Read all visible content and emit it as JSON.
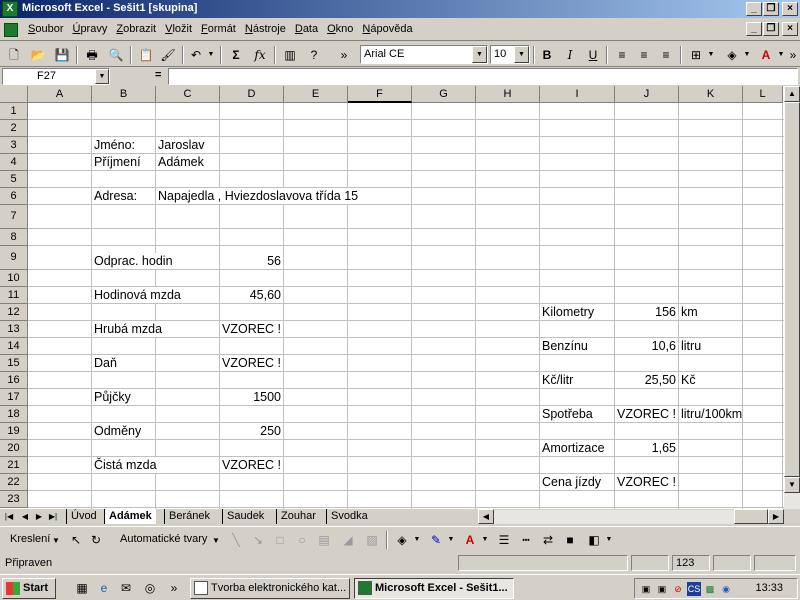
{
  "window": {
    "title": "Microsoft Excel - Sešit1  [skupina]"
  },
  "menu": [
    "Soubor",
    "Úpravy",
    "Zobrazit",
    "Vložit",
    "Formát",
    "Nástroje",
    "Data",
    "Okno",
    "Nápověda"
  ],
  "toolbar": {
    "font": "Arial CE",
    "size": "10"
  },
  "formula_bar": {
    "cell_ref": "F27",
    "eq": "=",
    "content": ""
  },
  "columns": [
    "A",
    "B",
    "C",
    "D",
    "E",
    "F",
    "G",
    "H",
    "I",
    "J",
    "K",
    "L"
  ],
  "rows": [
    "1",
    "2",
    "3",
    "4",
    "5",
    "6",
    "7",
    "8",
    "9",
    "10",
    "11",
    "12",
    "13",
    "14",
    "15",
    "16",
    "17",
    "18",
    "19",
    "20",
    "21",
    "22",
    "23"
  ],
  "cells": {
    "B3": "Jméno:",
    "C3": "Jaroslav",
    "B4": "Příjmení",
    "C4": "Adámek",
    "B6": "Adresa:",
    "C6": "Napajedla , Hviezdoslavova třída 15",
    "B9": "Odprac. hodin",
    "D9": "56",
    "B11": "Hodinová mzda",
    "D11": "45,60",
    "I12": "Kilometry",
    "J12": "156",
    "K12": "km",
    "B13": "Hrubá mzda",
    "D13": "VZOREC !",
    "I14": "Benzínu",
    "J14": "10,6",
    "K14": "litru",
    "B15": "Daň",
    "D15": "VZOREC !",
    "I16": "Kč/litr",
    "J16": "25,50",
    "K16": "Kč",
    "B17": "Půjčky",
    "D17": "1500",
    "I18": "Spotřeba",
    "J18": "VZOREC !",
    "K18": "litru/100km",
    "B19": "Odměny",
    "D19": "250",
    "I20": "Amortizace",
    "J20": "1,65",
    "B21": "Čistá mzda",
    "D21": "VZOREC !",
    "I22": "Cena jízdy",
    "J22": "VZOREC !"
  },
  "sheet_tabs": [
    "Úvod",
    "Adámek",
    "Beránek",
    "Saudek",
    "Zouhar",
    "Svodka"
  ],
  "active_tab": "Adámek",
  "drawing": {
    "draw_label": "Kreslení",
    "autoshapes_label": "Automatické tvary"
  },
  "status": {
    "text": "Připraven",
    "num": "123"
  },
  "taskbar": {
    "start": "Start",
    "tasks": [
      "Tvorba elektronického kat...",
      "Microsoft Excel - Sešit1..."
    ],
    "clock": "13:33",
    "tray_cs": "CS"
  }
}
